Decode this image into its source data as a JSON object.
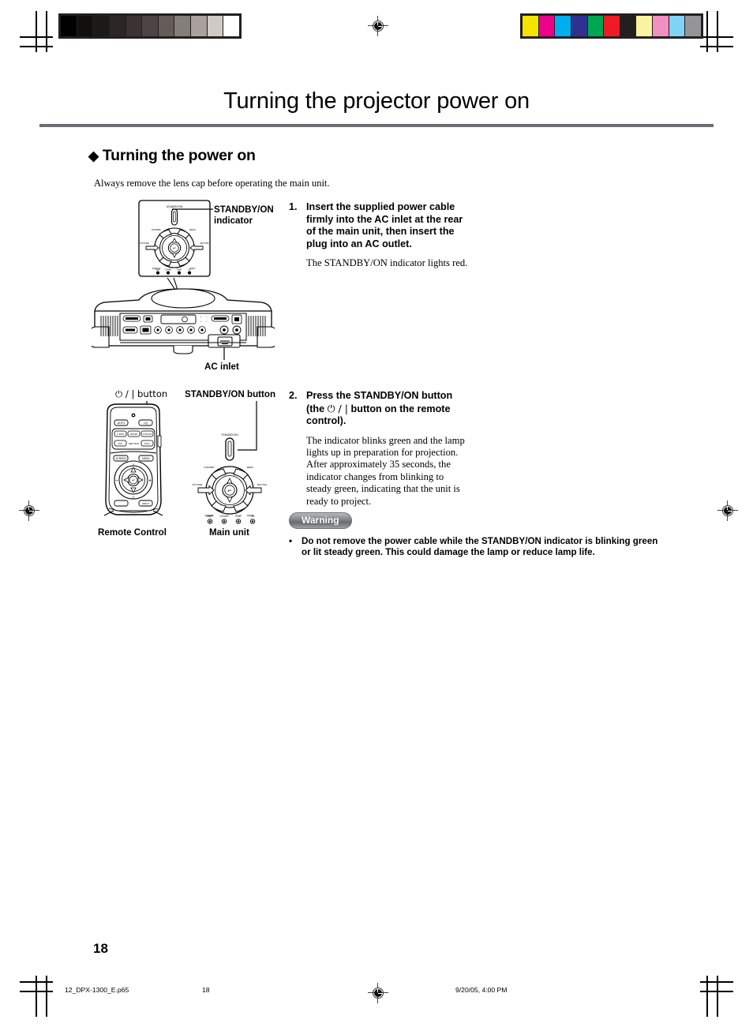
{
  "page": {
    "title": "Turning the projector power on",
    "section_heading": "Turning the power on",
    "diamond": "◆",
    "intro": "Always remove the lens cap before operating the main unit.",
    "page_number": "18"
  },
  "steps": [
    {
      "number": "1.",
      "heading": "Insert the supplied power cable firmly into the AC inlet at the rear of the main unit, then insert the plug into an AC outlet.",
      "paragraph": "The STANDBY/ON indicator lights red."
    },
    {
      "number": "2.",
      "heading_pre": "Press the STANDBY/ON button (the ",
      "heading_symbol": "⏻ / |",
      "heading_post": " button on the remote control).",
      "paragraph": "The indicator blinks green and the lamp lights up in preparation for projection. After approximately 35 seconds, the indicator changes from blinking to steady green, indicating that the unit is ready to project."
    }
  ],
  "warning": {
    "badge": "Warning",
    "bullet": "•",
    "text": "Do not remove the power cable while the STANDBY/ON indicator is blinking green or lit steady green. This could damage the lamp or reduce lamp life."
  },
  "figures": {
    "standby_indicator_label": "STANDBY/ON",
    "standby_indicator_label2": "indicator",
    "ac_inlet_label": "AC inlet",
    "power_button_label": "⏻ / | button",
    "standby_button_label": "STANDBY/ON button",
    "remote_caption": "Remote Control",
    "main_unit_caption": "Main unit",
    "panel_indicator_text": "STANDBY/ON",
    "remote_buttons": [
      "AUTO",
      "⏻/|",
      "V POS",
      "ZOOM",
      "FOCUS",
      "PIC",
      "SETTING",
      "PICT"
    ],
    "remote_lower_buttons": [
      "SCREEN",
      "MENU",
      "INPUT"
    ],
    "panel_arrow_labels": [
      "STANDBY",
      "MENU",
      "PICTURE",
      "SETTING",
      "ASPECT",
      "INPUT"
    ],
    "panel_led_labels": [
      "LAMP",
      "COVER",
      "TEMP",
      "ON"
    ]
  },
  "footer": {
    "file": "12_DPX-1300_E.p65",
    "page": "18",
    "timestamp": "9/20/05, 4:00 PM"
  },
  "calibration": {
    "gray_patches": [
      "#000000",
      "#120f0f",
      "#1d1919",
      "#2b2625",
      "#3a3332",
      "#4c4543",
      "#645c59",
      "#857d79",
      "#a9a19d",
      "#d0cac6",
      "#ffffff"
    ],
    "color_patches": [
      "#f5e400",
      "#ec008c",
      "#00aeef",
      "#2e3192",
      "#00a651",
      "#ed1c24",
      "#231f20",
      "#fcf3a0",
      "#f48fc2",
      "#7fd4f5",
      "#939598"
    ]
  }
}
